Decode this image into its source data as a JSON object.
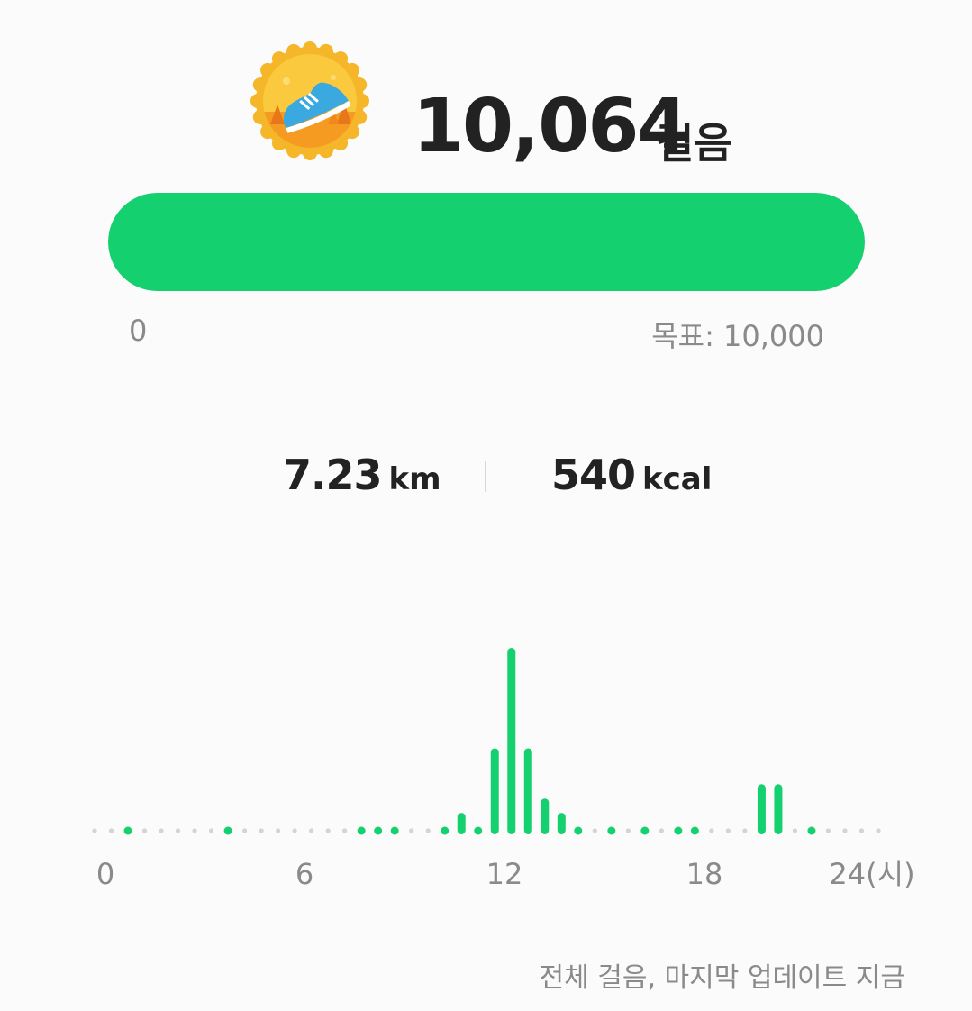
{
  "summary": {
    "steps_value": "10,064",
    "steps_unit": "걸음",
    "badge_icon": "running-shoe-badge-icon"
  },
  "progress": {
    "fraction": 1.0,
    "min_label": "0",
    "goal_label": "목표: 10,000",
    "color": "#15d06e"
  },
  "stats": {
    "distance_value": "7.23",
    "distance_unit": "km",
    "calories_value": "540",
    "calories_unit": "kcal"
  },
  "chart_data": {
    "type": "bar",
    "x_tick_labels": [
      "0",
      "6",
      "12",
      "18",
      "24(시)"
    ],
    "x": [
      0,
      0.5,
      1,
      1.5,
      2,
      2.5,
      3,
      3.5,
      4,
      4.5,
      5,
      5.5,
      6,
      6.5,
      7,
      7.5,
      8,
      8.5,
      9,
      9.5,
      10,
      10.5,
      11,
      11.5,
      12,
      12.5,
      13,
      13.5,
      14,
      14.5,
      15,
      15.5,
      16,
      16.5,
      17,
      17.5,
      18,
      18.5,
      19,
      19.5,
      20,
      20.5,
      21,
      21.5,
      22,
      22.5,
      23,
      23.5
    ],
    "values": [
      0,
      0,
      1,
      0,
      0,
      0,
      0,
      0,
      1,
      0,
      0,
      0,
      0,
      0,
      0,
      0,
      1,
      1,
      1,
      0,
      0,
      1,
      3,
      1,
      12,
      26,
      12,
      5,
      3,
      1,
      0,
      1,
      0,
      1,
      0,
      1,
      1,
      0,
      0,
      0,
      7,
      7,
      0,
      1,
      0,
      0,
      0,
      0
    ],
    "bar_color": "#15d06e",
    "empty_dot_color": "#d4d4d4"
  },
  "footer": {
    "status_text": "전체 걸음, 마지막 업데이트 지금"
  }
}
